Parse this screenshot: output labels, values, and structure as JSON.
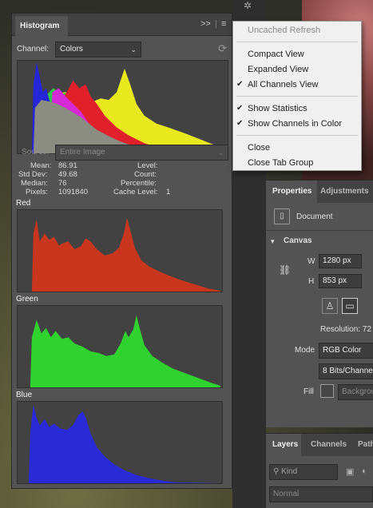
{
  "histogram_panel": {
    "tab_title": "Histogram",
    "collapse_glyph": ">>",
    "menu_glyph": "≡",
    "channel_label": "Channel:",
    "channel_value": "Colors",
    "source_label": "Source:",
    "source_value": "Entire Image",
    "stats": {
      "mean_label": "Mean:",
      "mean": "86.91",
      "std_label": "Std Dev:",
      "std": "49.68",
      "median_label": "Median:",
      "median": "76",
      "pixels_label": "Pixels:",
      "pixels": "1091840",
      "level_label": "Level:",
      "count_label": "Count:",
      "percentile_label": "Percentile:",
      "cache_label": "Cache Level:",
      "cache": "1"
    },
    "channels": [
      {
        "name": "Red",
        "color": "#c8361e"
      },
      {
        "name": "Green",
        "color": "#2fd22f"
      },
      {
        "name": "Blue",
        "color": "#2a2ad6"
      }
    ],
    "icons": {
      "refresh": "refresh-icon",
      "dropdown": "chevron-down-icon",
      "menu": "hamburger-icon"
    }
  },
  "flyout_menu": {
    "items": [
      {
        "label": "Uncached Refresh",
        "checked": false,
        "disabled": true
      },
      {
        "label": "Compact View",
        "checked": false
      },
      {
        "label": "Expanded View",
        "checked": false
      },
      {
        "label": "All Channels View",
        "checked": true
      },
      {
        "label": "Show Statistics",
        "checked": true
      },
      {
        "label": "Show Channels in Color",
        "checked": true
      },
      {
        "label": "Close",
        "checked": false
      },
      {
        "label": "Close Tab Group",
        "checked": false
      }
    ],
    "check_glyph": "✔"
  },
  "properties_panel": {
    "tabs": [
      "Properties",
      "Adjustments"
    ],
    "doc_label": "Document",
    "canvas_label": "Canvas",
    "w_label": "W",
    "w_value": "1280 px",
    "h_label": "H",
    "h_value": "853 px",
    "resolution_label": "Resolution: 72",
    "mode_label": "Mode",
    "mode_value": "RGB Color",
    "bits_value": "8 Bits/Channel",
    "fill_label": "Fill",
    "fill_value": "Background"
  },
  "layers_panel": {
    "tabs": [
      "Layers",
      "Channels",
      "Paths"
    ],
    "kind_placeholder": "Kind",
    "blend_value": "Normal"
  }
}
